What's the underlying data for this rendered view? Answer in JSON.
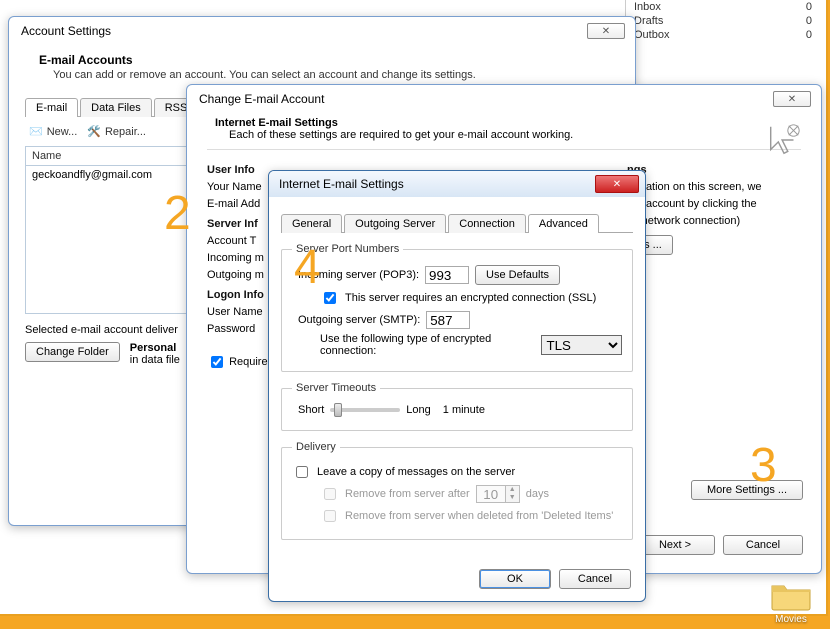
{
  "folders": {
    "inbox": {
      "label": "Inbox",
      "count": "0"
    },
    "drafts": {
      "label": "Drafts",
      "count": "0"
    },
    "outbox": {
      "label": "Outbox",
      "count": "0"
    }
  },
  "acct": {
    "title": "Account Settings",
    "heading": "E-mail Accounts",
    "sub": "You can add or remove an account. You can select an account and change its settings.",
    "tabs": {
      "email": "E-mail",
      "data": "Data Files",
      "rss": "RSS Feed"
    },
    "toolbar": {
      "new": "New...",
      "repair": "Repair..."
    },
    "list_header": "Name",
    "email_row": "geckoandfly@gmail.com",
    "selected": "Selected e-mail account deliver",
    "change_folder": "Change Folder",
    "personal": "Personal",
    "datafile": "in data file"
  },
  "chg": {
    "title": "Change E-mail Account",
    "heading": "Internet E-mail Settings",
    "sub": "Each of these settings are required to get your e-mail account working.",
    "userinfo": "User Info",
    "yourname": "Your Name",
    "emailaddr": "E-mail Add",
    "serverinfo": "Server Inf",
    "accounttype": "Account T",
    "incoming": "Incoming m",
    "outgoing": "Outgoing m",
    "logoninfo": "Logon Info",
    "username": "User Name",
    "password": "Password",
    "require_cb": "Require",
    "side_heading": "ngs",
    "side_line1": "ormation on this screen, we",
    "side_line2": "our account by clicking the",
    "side_line3": "es network connection)",
    "testbtn": "gs ...",
    "more": "More Settings ...",
    "next": "Next >",
    "cancel": "Cancel"
  },
  "dlg": {
    "title": "Internet E-mail Settings",
    "tabs": {
      "general": "General",
      "outgoing": "Outgoing Server",
      "conn": "Connection",
      "adv": "Advanced"
    },
    "portnumbers": "Server Port Numbers",
    "incoming_label": "Incoming server (POP3):",
    "incoming_value": "993",
    "use_defaults": "Use Defaults",
    "ssl_cb": "This server requires an encrypted connection (SSL)",
    "outgoing_label": "Outgoing server (SMTP):",
    "outgoing_value": "587",
    "enc_label": "Use the following type of encrypted connection:",
    "enc_value": "TLS",
    "timeouts": "Server Timeouts",
    "short": "Short",
    "long": "Long",
    "timeout_value": "1 minute",
    "delivery": "Delivery",
    "leavecopy": "Leave a copy of messages on the server",
    "removeafter": "Remove from server after",
    "removeafter_days": "10",
    "days": "days",
    "removedeleted": "Remove from server when deleted from 'Deleted Items'",
    "ok": "OK",
    "cancel": "Cancel"
  },
  "anno": {
    "n2": "2",
    "n3": "3",
    "n4": "4"
  },
  "desk": {
    "movies": "Movies"
  }
}
